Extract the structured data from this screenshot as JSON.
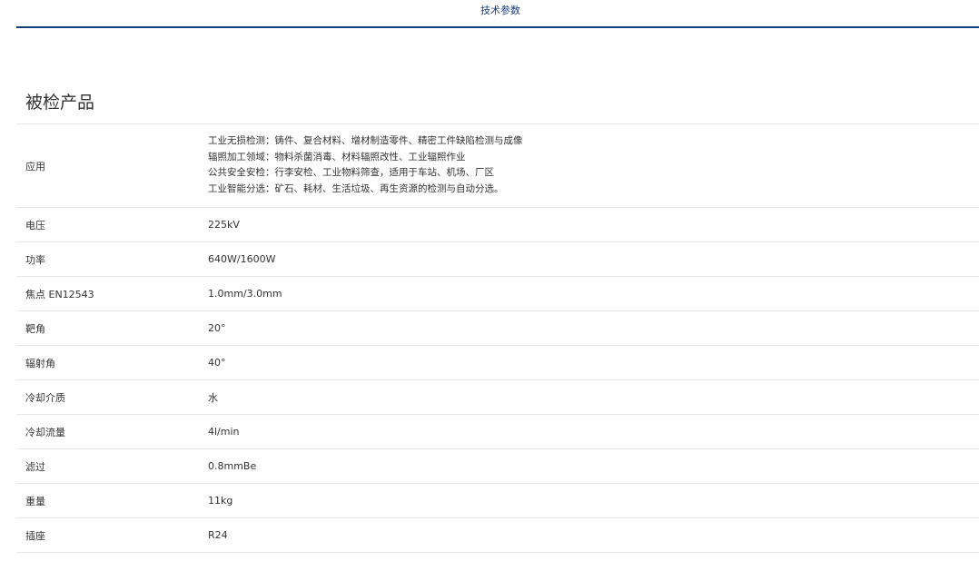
{
  "tabs": {
    "active_label": "技术参数"
  },
  "section": {
    "title": "被检产品"
  },
  "specs": {
    "application": {
      "label": "应用",
      "lines": [
        "工业无损检测：铸件、复合材料、增材制造零件、精密工件缺陷检测与成像",
        "辐照加工领域：物料杀菌消毒、材料辐照改性、工业辐照作业",
        "公共安全安检：行李安检、工业物料筛查，适用于车站、机场、厂区",
        "工业智能分选：矿石、耗材、生活垃圾、再生资源的检测与自动分选。"
      ]
    },
    "rows": [
      {
        "label": "电压",
        "value": "225kV"
      },
      {
        "label": "功率",
        "value": "640W/1600W"
      },
      {
        "label": "焦点 EN12543",
        "value": "1.0mm/3.0mm"
      },
      {
        "label": "靶角",
        "value": "20°"
      },
      {
        "label": "辐射角",
        "value": "40°"
      },
      {
        "label": "冷却介质",
        "value": "水"
      },
      {
        "label": "冷却流量",
        "value": "4l/min"
      },
      {
        "label": "滤过",
        "value": "0.8mmBe"
      },
      {
        "label": "重量",
        "value": "11kg"
      },
      {
        "label": "插座",
        "value": "R24"
      }
    ]
  },
  "colors": {
    "accent": "#1a3c7a",
    "divider": "#e6e6e6",
    "text": "#333333"
  }
}
